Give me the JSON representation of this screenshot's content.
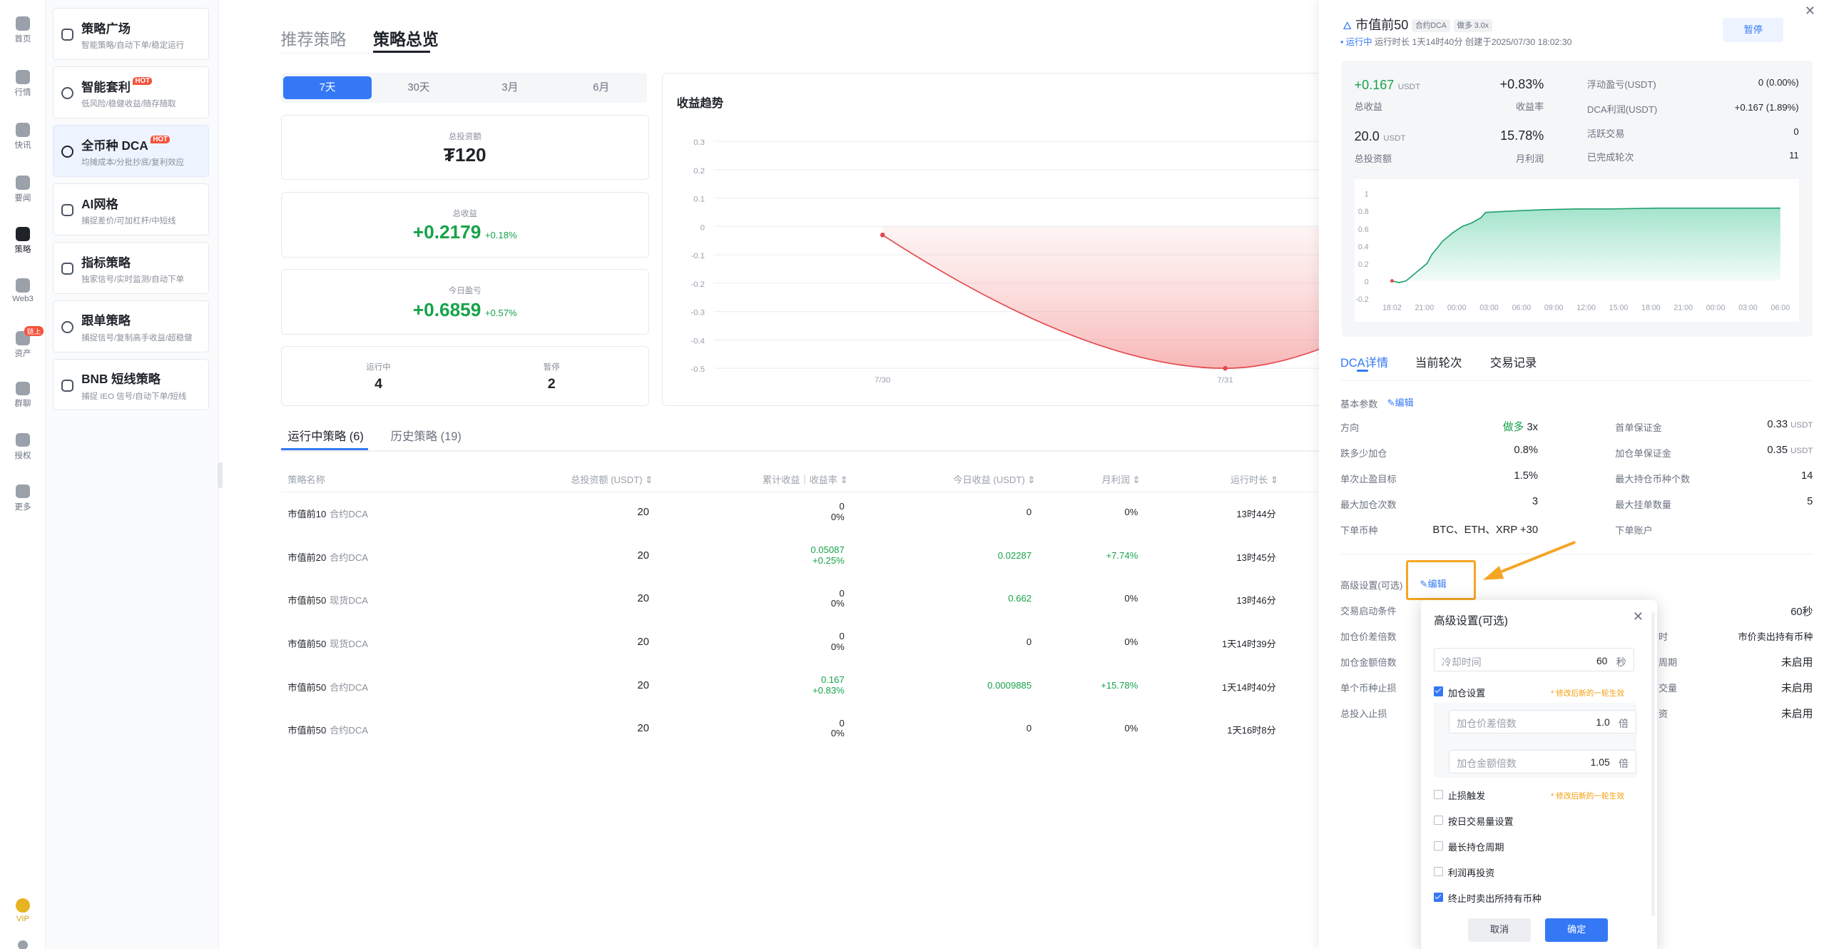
{
  "rail": {
    "items": [
      {
        "label": "首页"
      },
      {
        "label": "行情"
      },
      {
        "label": "快讯"
      },
      {
        "label": "要闻"
      },
      {
        "label": "策略"
      },
      {
        "label": "Web3"
      },
      {
        "label": "资产",
        "badge": "链上"
      },
      {
        "label": "群聊"
      },
      {
        "label": "授权"
      },
      {
        "label": "更多"
      },
      {
        "label": "VIP"
      }
    ]
  },
  "menu": {
    "items": [
      {
        "title": "策略广场",
        "sub": "智能策略/自动下单/稳定运行"
      },
      {
        "title": "智能套利",
        "hot": "HOT",
        "sub": "低风险/稳健收益/随存随取"
      },
      {
        "title": "全币种 DCA",
        "hot": "HOT",
        "sub": "均摊成本/分批抄底/复利效应"
      },
      {
        "title": "AI网格",
        "sub": "捕捉差价/可加杠杆/中短线"
      },
      {
        "title": "指标策略",
        "sub": "独家信号/实时监测/自动下单"
      },
      {
        "title": "跟单策略",
        "sub": "捕捉信号/复制高手收益/超稳健"
      },
      {
        "title": "BNB 短线策略",
        "sub": "捕捉 IEO 信号/自动下单/短线"
      }
    ]
  },
  "main": {
    "tabs": [
      "推荐策略",
      "策略总览"
    ],
    "periods": [
      "7天",
      "30天",
      "3月",
      "6月"
    ],
    "total_invest_label": "总投资额",
    "total_invest": "₮120",
    "total_profit_label": "总收益",
    "total_profit": "+0.2179",
    "total_profit_pct": "+0.18%",
    "today_label": "今日盈亏",
    "today": "+0.6859",
    "today_pct": "+0.57%",
    "running_label": "运行中",
    "running": "4",
    "paused_label": "暂停",
    "paused": "2",
    "chart_title": "收益趋势",
    "subtabs": [
      "运行中策略 (6)",
      "历史策略 (19)"
    ],
    "table": {
      "headers": [
        "策略名称",
        "总投资额 (USDT)",
        "累计收益｜收益率",
        "今日收益 (USDT)",
        "月利润",
        "运行时长"
      ],
      "rows": [
        {
          "name": "市值前10",
          "type": "合约DCA",
          "invest": "20",
          "profit": "0",
          "rate": "0%",
          "today": "0",
          "month": "0%",
          "dur": "13时44分"
        },
        {
          "name": "市值前20",
          "type": "合约DCA",
          "invest": "20",
          "profit": "0.05087",
          "rate": "+0.25%",
          "today": "0.02287",
          "month": "+7.74%",
          "dur": "13时45分"
        },
        {
          "name": "市值前50",
          "type": "现货DCA",
          "invest": "20",
          "profit": "0",
          "rate": "0%",
          "today": "0.662",
          "month": "0%",
          "dur": "13时46分"
        },
        {
          "name": "市值前50",
          "type": "现货DCA",
          "invest": "20",
          "profit": "0",
          "rate": "0%",
          "today": "0",
          "month": "0%",
          "dur": "1天14时39分"
        },
        {
          "name": "市值前50",
          "type": "合约DCA",
          "invest": "20",
          "profit": "0.167",
          "rate": "+0.83%",
          "today": "0.0009885",
          "month": "+15.78%",
          "dur": "1天14时40分"
        },
        {
          "name": "市值前50",
          "type": "合约DCA",
          "invest": "20",
          "profit": "0",
          "rate": "0%",
          "today": "0",
          "month": "0%",
          "dur": "1天16时8分"
        }
      ]
    }
  },
  "chart_data": [
    {
      "type": "area",
      "title": "收益趋势",
      "x": [
        "7/30",
        "7/31"
      ],
      "yticks": [
        "0.3",
        "0.2",
        "0.1",
        "0",
        "-0.1",
        "-0.2",
        "-0.3",
        "-0.4",
        "-0.5"
      ],
      "ylim": [
        -0.5,
        0.3
      ],
      "series": [
        {
          "values": [
            -0.03,
            -0.5
          ]
        }
      ]
    },
    {
      "type": "area",
      "yticks": [
        "1",
        "0.8",
        "0.6",
        "0.4",
        "0.2",
        "0",
        "-0.2"
      ],
      "ylim": [
        -0.2,
        1
      ],
      "x": [
        "18:02",
        "21:00",
        "00:00",
        "03:00",
        "06:00",
        "09:00",
        "12:00",
        "15:00",
        "18:00",
        "21:00",
        "00:00",
        "03:00",
        "06:00"
      ],
      "series": [
        {
          "values": [
            0,
            -0.02,
            0,
            0.2,
            0.3,
            0.38,
            0.45,
            0.55,
            0.62,
            0.66,
            0.72,
            0.78,
            0.8,
            0.81,
            0.82,
            0.82,
            0.83,
            0.83,
            0.83,
            0.83,
            0.83
          ]
        }
      ]
    }
  ],
  "panel": {
    "title": "市值前50",
    "tag1": "合约DCA",
    "tag2": "做多 3.0x",
    "status": "运行中",
    "meta": "运行时长 1天14时40分 创建于2025/07/30 18:02:30",
    "pause": "暂停",
    "profit": "+0.167",
    "profit_unit": "USDT",
    "profit_label": "总收益",
    "rate": "+0.83%",
    "rate_label": "收益率",
    "invest": "20.0",
    "invest_unit": "USDT",
    "invest_label": "总投资额",
    "month": "15.78%",
    "month_label": "月利润",
    "float_label": "浮动盈亏(USDT)",
    "float_val": "0 (0.00%)",
    "dca_label": "DCA利润(USDT)",
    "dca_val": "+0.167 (1.89%)",
    "active_label": "活跃交易",
    "active_val": "0",
    "done_label": "已完成轮次",
    "done_val": "11",
    "tabs": [
      "DCA详情",
      "当前轮次",
      "交易记录"
    ],
    "basic_label": "基本参数",
    "edit": "编辑",
    "params_left": [
      {
        "k": "方向",
        "v": "做多",
        "v2": "3x"
      },
      {
        "k": "跌多少加仓",
        "v": "0.8%"
      },
      {
        "k": "单次止盈目标",
        "v": "1.5%"
      },
      {
        "k": "最大加仓次数",
        "v": "3"
      },
      {
        "k": "下单币种",
        "v": "BTC、ETH、XRP +30"
      }
    ],
    "params_right": [
      {
        "k": "首单保证金",
        "v": "0.33",
        "u": "USDT"
      },
      {
        "k": "加仓单保证金",
        "v": "0.35",
        "u": "USDT"
      },
      {
        "k": "最大持仓币种个数",
        "v": "14"
      },
      {
        "k": "最大挂单数量",
        "v": "5"
      },
      {
        "k": "下单账户",
        "v": ""
      }
    ],
    "adv_label": "高级设置(可选)",
    "adv_left": [
      "交易启动条件",
      "加仓价差倍数",
      "加仓金额倍数",
      "单个币种止损",
      "总投入止损"
    ],
    "adv_right": [
      {
        "k": "",
        "v": "60秒"
      },
      {
        "k": "时",
        "v": "市价卖出持有币种"
      },
      {
        "k": "周期",
        "v": "未启用"
      },
      {
        "k": "交量",
        "v": "未启用"
      },
      {
        "k": "资",
        "v": "未启用"
      }
    ]
  },
  "popup": {
    "title": "高级设置(可选)",
    "cooldown_ph": "冷却时间",
    "cooldown_val": "60",
    "cooldown_unit": "秒",
    "add_label": "加仓设置",
    "add_warn": "* 修改后新的一轮生效",
    "gap_ph": "加仓价差倍数",
    "gap_val": "1.0",
    "gap_unit": "倍",
    "amt_ph": "加仓金额倍数",
    "amt_val": "1.05",
    "amt_unit": "倍",
    "sl_label": "止损触发",
    "sl_warn": "* 修改后新的一轮生效",
    "opts": [
      "按日交易量设置",
      "最长持仓周期",
      "利润再投资",
      "终止时卖出所持有币种"
    ],
    "cancel": "取消",
    "confirm": "确定"
  },
  "colors": {
    "accent": "#3478f6",
    "green": "#16a34a",
    "red": "#e5484d",
    "highlight": "#f5a524"
  }
}
